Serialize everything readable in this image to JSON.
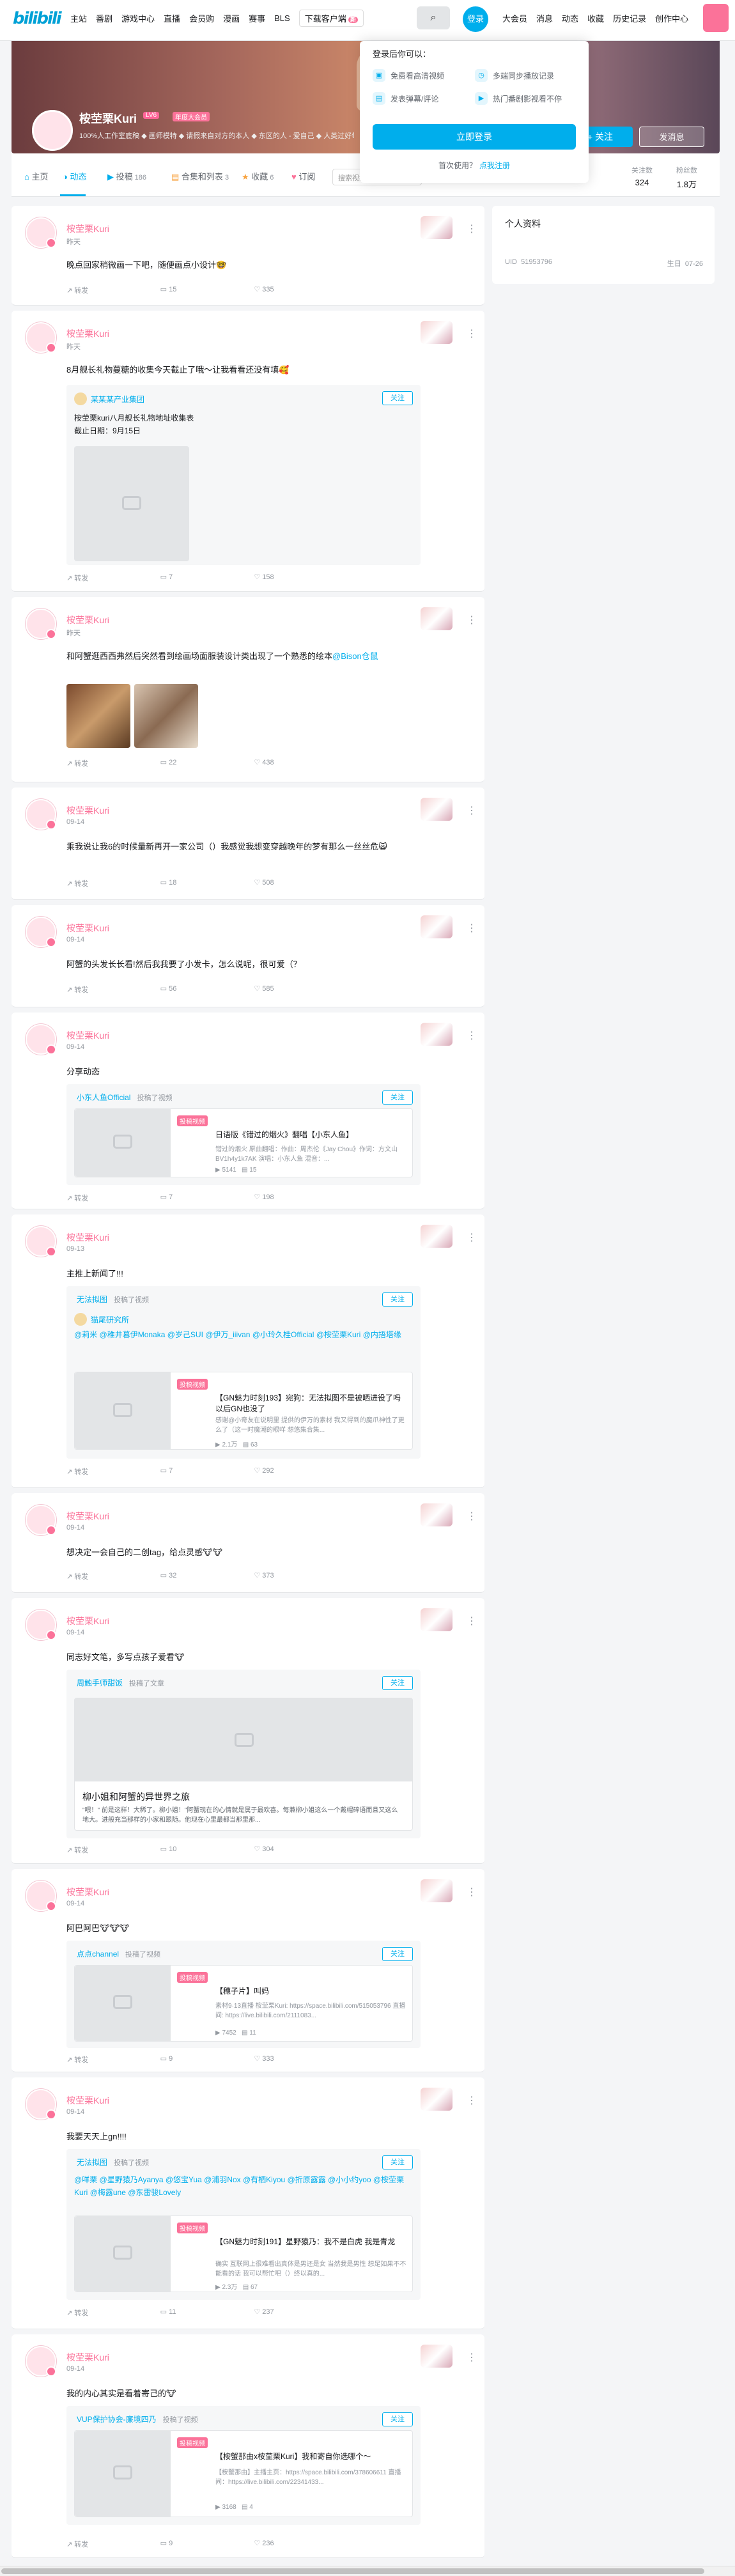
{
  "nav": {
    "main": "主站",
    "items": [
      "番剧",
      "游戏中心",
      "直播",
      "会员购",
      "漫画",
      "赛事",
      "BLS"
    ],
    "download": "下载客户端",
    "download_badge": "新",
    "login": "登录",
    "right": [
      "大会员",
      "消息",
      "动态",
      "收藏",
      "历史记录",
      "创作中心"
    ]
  },
  "profile": {
    "name": "桉茔栗Kuri",
    "level": "LV6",
    "vip": "年度大会员",
    "sign": "100%人工作室底稿 ◆ 画师模特 ◆ 请假来自对方的本人 ◆ 东区的人 - 爱自己 ◆ 人类过好每一天",
    "follow": "+ 关注",
    "message": "发消息"
  },
  "tabs": [
    {
      "label": "主页",
      "count": ""
    },
    {
      "label": "动态",
      "count": ""
    },
    {
      "label": "投稿",
      "count": "186"
    },
    {
      "label": "合集和列表",
      "count": "3"
    },
    {
      "label": "收藏",
      "count": "6"
    },
    {
      "label": "订阅",
      "count": ""
    }
  ],
  "space_search": "搜索视频、动态",
  "stats": {
    "following_label": "关注数",
    "following": "324",
    "followers_label": "粉丝数",
    "followers": "1.8万"
  },
  "popup": {
    "title": "登录后你可以：",
    "features": [
      "免费看高清视频",
      "多端同步播放记录",
      "发表弹幕/评论",
      "热门番剧影视看不停"
    ],
    "login": "立即登录",
    "first": "首次使用？",
    "register": "点我注册"
  },
  "side": {
    "title": "个人资料",
    "uid_label": "UID",
    "uid": "51953796",
    "birthday_label": "生日",
    "birthday": "07-26"
  },
  "feed": [
    {
      "name": "桉茔栗Kuri",
      "time": "昨天",
      "text": "晚点回家稍微画一下吧，随便画点小设计🤓",
      "fwd": "转发",
      "cmt": "15",
      "like": "335"
    },
    {
      "name": "桉茔栗Kuri",
      "time": "昨天",
      "text": "8月舰长礼物蔓糖的收集今天截止了哦～让我看看还没有填🥰",
      "ann_user": "某某某产业集团",
      "ann_follow": "关注",
      "ann_l1": "桉茔栗kuri八月舰长礼物地址收集表",
      "ann_l2": "截止日期：9月15日",
      "fwd": "转发",
      "cmt": "7",
      "like": "158"
    },
    {
      "name": "桉茔栗Kuri",
      "time": "昨天",
      "text": "和阿蟹逛西西弗然后突然看到绘画场面服装设计类出现了一个熟悉的绘本",
      "mention": "@Bison仓鼠",
      "fwd": "转发",
      "cmt": "22",
      "like": "438"
    },
    {
      "name": "桉茔栗Kuri",
      "time": "09-14",
      "text": "乘我说让我6的时候量新再开一家公司（）我感觉我想变穿越晚年的梦有那么一丝丝危🙀",
      "fwd": "转发",
      "cmt": "18",
      "like": "508"
    },
    {
      "name": "桉茔栗Kuri",
      "time": "09-14",
      "text": "阿蟹的头发长长看!然后我我要了小发卡，怎么说呢，很可爱（？",
      "fwd": "转发",
      "cmt": "56",
      "like": "585"
    },
    {
      "name": "桉茔栗Kuri",
      "time": "09-14",
      "text": "分享动态",
      "up": "小东人鱼Official",
      "up_act": "投稿了视频",
      "follow": "关注",
      "badge": "投稿视频",
      "vtitle": "日语版《错过的烟火》翻唱【小东人鱼】",
      "vdesc": "错过的烟火 原曲翻唱：作曲：周杰伦《Jay Chou》作词：方文山 BV1h4y1k7AK 演唱：小东人鱼 混音：...",
      "vplay": "5141",
      "vdm": "15",
      "fwd": "转发",
      "cmt": "7",
      "like": "198"
    },
    {
      "name": "桉茔栗Kuri",
      "time": "09-13",
      "text": "主推上新闻了!!!",
      "up": "无法拟图",
      "up_act": "投稿了视频",
      "follow": "关注",
      "ann_user": "猫尾研究所",
      "ats": [
        "@莉米",
        "@稚井暮伊Monaka",
        "@岁己SUI",
        "@伊万_iiivan",
        "@小玲久桂Official",
        "@桉茔栗Kuri",
        "@内捂塔缘"
      ],
      "badge": "投稿视频",
      "vtitle": "【GN魅力时刻193】宛狗：无法拟图不是被晒进役了吗 以后GN也没了",
      "vdesc": "感谢@小奇友在说明里 提供的伊万的素材 我又得到的魔爪神性了更么了（这一时魔潮的眼咩 想悠集合集...",
      "vplay": "2.1万",
      "vdm": "63",
      "fwd": "转发",
      "cmt": "7",
      "like": "292"
    },
    {
      "name": "桉茔栗Kuri",
      "time": "09-14",
      "text": "想决定一会自己的二创tag，给点灵感🐮🐮",
      "fwd": "转发",
      "cmt": "32",
      "like": "373"
    },
    {
      "name": "桉茔栗Kuri",
      "time": "09-14",
      "text": "同志好文笔，多写点孩子爱看🐮",
      "up": "周触手师甜饭",
      "up_act": "投稿了文章",
      "follow": "关注",
      "art_title": "柳小姐和阿蟹的异世界之旅",
      "art_desc": "\"喂！\" 前是这样！大稀了。柳小姐！\"阿蟹现在的心情就是属于最欢喜。每兼柳小姐这么一个戴帽碎语而且又这么地大。进般充当那样的小家和跟随。他现在心里最都当那里那...",
      "fwd": "转发",
      "cmt": "10",
      "like": "304"
    },
    {
      "name": "桉茔栗Kuri",
      "time": "09-14",
      "text": "阿巴阿巴🐮🐮🐮",
      "up": "点点channel",
      "up_act": "投稿了视频",
      "follow": "关注",
      "badge": "投稿视频",
      "vtitle": "【穗子片】叫妈",
      "vdesc": "素材9·13直播 桉茔栗Kuri: https://space.bilibili.com/515053796 直播间: https://live.bilibili.com/2111083...",
      "vplay": "7452",
      "vdm": "11",
      "fwd": "转发",
      "cmt": "9",
      "like": "333"
    },
    {
      "name": "桉茔栗Kuri",
      "time": "09-14",
      "text": "我要天天上gn!!!!",
      "up": "无法拟图",
      "up_act": "投稿了视频",
      "follow": "关注",
      "ats": [
        "@咩栗",
        "@星野猿乃Ayanya",
        "@悠宝Yua",
        "@浦羽Nox",
        "@有栖Kiyou",
        "@折原露露",
        "@小小约yoo",
        "@桉茔栗Kuri",
        "@梅露une",
        "@东雷骏Lovely"
      ],
      "badge": "投稿视频",
      "vtitle": "【GN魅力时刻191】星野猿乃：我不是白虎 我是青龙",
      "vdesc": "确实 互联网上很难看出真体是男还是女 当然我是男性 想足如果不不能看的话 我可以帮忙吧（）终以真的...",
      "vplay": "2.3万",
      "vdm": "67",
      "fwd": "转发",
      "cmt": "11",
      "like": "237"
    },
    {
      "name": "桉茔栗Kuri",
      "time": "09-14",
      "text": "我的内心其实是看着寄己的🐮",
      "up": "VUP保护协会-廉境四乃",
      "up_act": "投稿了视频",
      "follow": "关注",
      "badge": "投稿视频",
      "vtitle": "【桉蟹那由x桉茔栗Kuri】我和寄自你选哪个～",
      "vdesc": "【桉蟹那由】主播主页：https://space.bilibili.com/378606611 直播间：https://live.bilibili.com/22341433...",
      "vplay": "3168",
      "vdm": "4",
      "fwd": "转发",
      "cmt": "9",
      "like": "236"
    }
  ],
  "colors": {
    "accent": "#00aeec",
    "pink": "#fb7299"
  }
}
